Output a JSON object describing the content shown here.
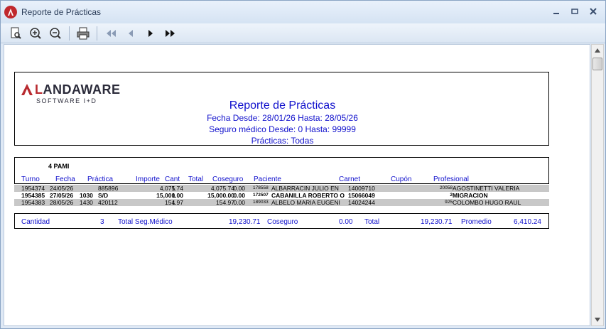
{
  "window": {
    "title": "Reporte de Prácticas",
    "controls": [
      "–",
      "▭",
      "X"
    ]
  },
  "toolbar": {
    "buttons": [
      "preview",
      "zoom-in",
      "zoom-out",
      "print",
      "first",
      "prev",
      "next",
      "last"
    ]
  },
  "logo": {
    "brand": "LANDAWARE",
    "tagline": "SOFTWARE I+D"
  },
  "report": {
    "title": "Reporte de Prácticas",
    "fecha": "Fecha Desde: 28/01/26 Hasta: 28/05/26",
    "seguro": "Seguro médico Desde: 0 Hasta: 99999",
    "practicas": "Prácticas: Todas"
  },
  "group": {
    "label": "4 PAMI"
  },
  "columns": [
    "Turno",
    "Fecha",
    "Práctica",
    "Importe",
    "Cant",
    "Total",
    "Coseguro",
    "Paciente",
    "Carnet",
    "Cupón",
    "Profesional"
  ],
  "rows": [
    {
      "turno": "1954374",
      "fecha": "24/05/26",
      "cod": "",
      "practica": "885896",
      "importe": "4,075.74",
      "cant": "1",
      "total": "4,075.74",
      "coseguro": "0.00",
      "pac_id": "178558",
      "paciente": "ALBARRACIN JULIO EN",
      "carnet": "14009710",
      "prof_id": "20058",
      "profesional": "AGOSTINETTI VALERIA",
      "shaded": true,
      "bold": false
    },
    {
      "turno": "1954385",
      "fecha": "27/05/26",
      "cod": "1030",
      "practica": "S/D",
      "importe": "15,000.00",
      "cant": "1",
      "total": "15,000.00",
      "coseguro": "0.00",
      "pac_id": "172507",
      "paciente": "CABANILLA ROBERTO O",
      "carnet": "15066049",
      "prof_id": "2",
      "profesional": "MIGRACION",
      "shaded": false,
      "bold": true
    },
    {
      "turno": "1954383",
      "fecha": "28/05/26",
      "cod": "1430",
      "practica": "420112",
      "importe": "154.97",
      "cant": "1",
      "total": "154.97",
      "coseguro": "0.00",
      "pac_id": "189033",
      "paciente": "ALBELO MARIA EUGENI",
      "carnet": "14024244",
      "prof_id": "925",
      "profesional": "COLOMBO HUGO RAUL",
      "shaded": true,
      "bold": false
    }
  ],
  "totals": {
    "cantidad_label": "Cantidad",
    "cantidad": "3",
    "seg_label": "Total Seg.Médico",
    "seg": "19,230.71",
    "coseguro_label": "Coseguro",
    "coseguro": "0.00",
    "total_label": "Total",
    "total": "19,230.71",
    "promedio_label": "Promedio",
    "promedio": "6,410.24"
  },
  "colors": {
    "report_blue": "#1010cc",
    "brand_red": "#b82a2f",
    "row_shade": "#c8c8c8"
  }
}
